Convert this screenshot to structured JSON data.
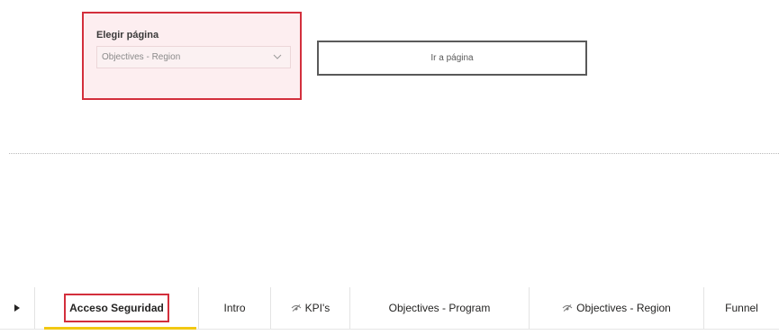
{
  "slicer": {
    "title": "Elegir página",
    "selected": "Objectives - Region"
  },
  "go_button": {
    "label": "Ir a página"
  },
  "tabs": [
    {
      "label": "Acceso Seguridad",
      "active": true,
      "hidden": false
    },
    {
      "label": "Intro",
      "active": false,
      "hidden": false
    },
    {
      "label": "KPI's",
      "active": false,
      "hidden": true
    },
    {
      "label": "Objectives - Program",
      "active": false,
      "hidden": false
    },
    {
      "label": "Objectives - Region",
      "active": false,
      "hidden": true
    },
    {
      "label": "Funnel",
      "active": false,
      "hidden": false
    }
  ],
  "icons": {
    "nav": "play-right-icon",
    "dropdown": "chevron-down-icon",
    "hidden_page": "hidden-eye-icon"
  },
  "colors": {
    "highlight": "#d32f3c",
    "active_underline": "#f2c811"
  }
}
